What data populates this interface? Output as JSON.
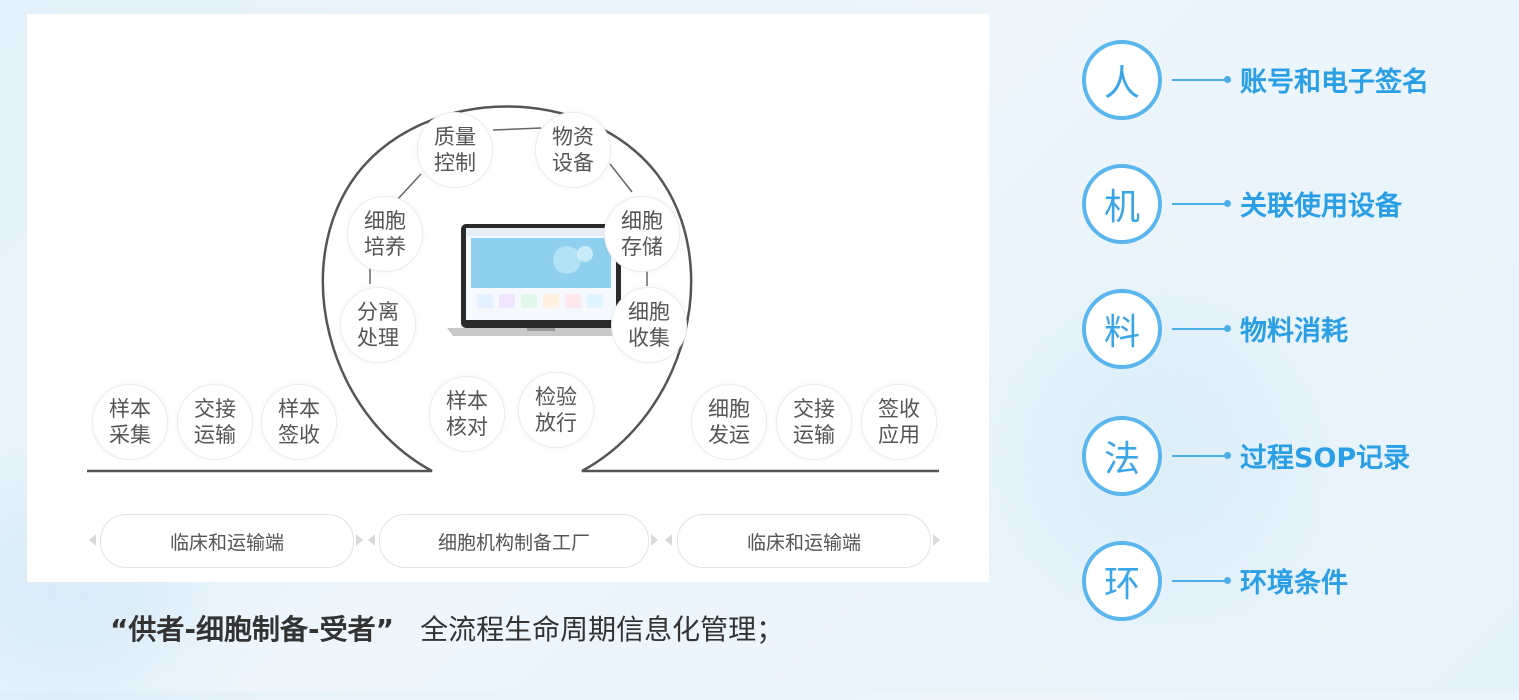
{
  "diagram": {
    "process_nodes": [
      {
        "id": "quality-control",
        "label": "质量控制"
      },
      {
        "id": "materials-equipment",
        "label": "物资设备"
      },
      {
        "id": "cell-culture",
        "label": "细胞培养"
      },
      {
        "id": "cell-storage",
        "label": "细胞存储"
      },
      {
        "id": "separation",
        "label": "分离处理"
      },
      {
        "id": "cell-harvest",
        "label": "细胞收集"
      },
      {
        "id": "sample-check",
        "label": "样本核对"
      },
      {
        "id": "inspection-release",
        "label": "检验放行"
      }
    ],
    "left_nodes": [
      {
        "id": "sample-collection",
        "label": "样本采集"
      },
      {
        "id": "handover-transport-left",
        "label": "交接运输"
      },
      {
        "id": "sample-receipt",
        "label": "样本签收"
      }
    ],
    "right_nodes": [
      {
        "id": "cell-dispatch",
        "label": "细胞发运"
      },
      {
        "id": "handover-transport-right",
        "label": "交接运输"
      },
      {
        "id": "receipt-application",
        "label": "签收应用"
      }
    ],
    "regions": [
      {
        "id": "clinic-left",
        "label": "临床和运输端"
      },
      {
        "id": "factory",
        "label": "细胞机构制备工厂"
      },
      {
        "id": "clinic-right",
        "label": "临床和运输端"
      }
    ]
  },
  "caption": {
    "bold": "“供者-细胞制备-受者”",
    "normal": "全流程生命周期信息化管理；"
  },
  "factors": [
    {
      "char": "人",
      "label": "账号和电子签名"
    },
    {
      "char": "机",
      "label": "关联使用设备"
    },
    {
      "char": "料",
      "label": "物料消耗"
    },
    {
      "char": "法",
      "label": "过程SOP记录"
    },
    {
      "char": "环",
      "label": "环境条件"
    }
  ],
  "colors": {
    "accent": "#2b9fe6",
    "ring": "#5bb5ee",
    "node_text": "#555555"
  }
}
